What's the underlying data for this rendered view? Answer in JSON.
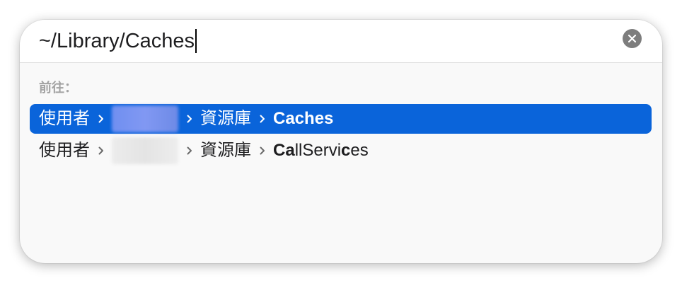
{
  "path_input": {
    "value": "~/Library/Caches"
  },
  "icons": {
    "clear": "xmark-circle-icon",
    "separator": "chevron-right-icon"
  },
  "colors": {
    "selection": "#0a64da",
    "label": "#a3a3a3"
  },
  "section_label": "前往：",
  "suggestions": [
    {
      "selected": true,
      "parts": [
        "使用者",
        "資源庫"
      ],
      "leaf": [
        {
          "text": "Caches",
          "match": true
        }
      ]
    },
    {
      "selected": false,
      "parts": [
        "使用者",
        "資源庫"
      ],
      "leaf": [
        {
          "text": "Ca",
          "match": true
        },
        {
          "text": "llServi",
          "match": false
        },
        {
          "text": "c",
          "match": true
        },
        {
          "text": "es",
          "match": false
        }
      ]
    }
  ]
}
